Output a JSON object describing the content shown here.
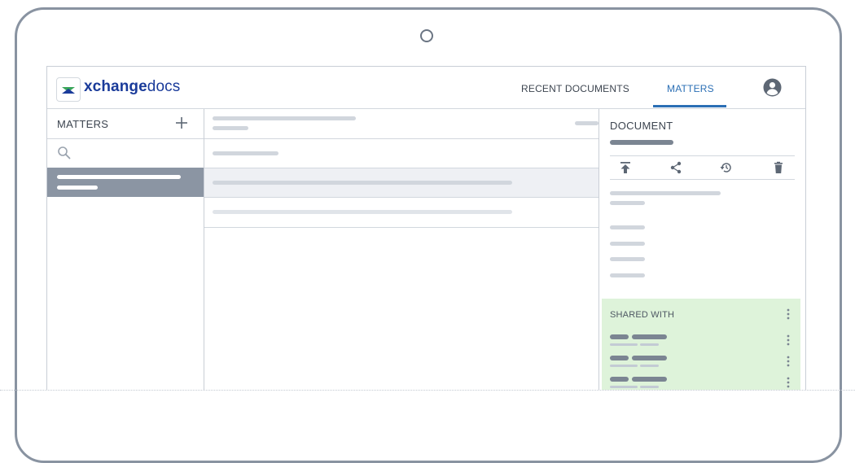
{
  "app": {
    "brand_bold": "xchange",
    "brand_light": "docs",
    "logo_colors": {
      "green": "#3aa55a",
      "navy": "#1a3b9a"
    }
  },
  "nav": {
    "recent_documents": "RECENT DOCUMENTS",
    "matters": "MATTERS",
    "active_tab": "MATTERS",
    "accent_color": "#2b6fb5"
  },
  "left_panel": {
    "title": "MATTERS",
    "add_icon": "plus-icon",
    "search_icon": "search-icon"
  },
  "document_panel": {
    "title": "DOCUMENT",
    "toolbar_icons": [
      "upload-icon",
      "share-icon",
      "history-icon",
      "trash-icon"
    ]
  },
  "shared_with": {
    "title": "SHARED WITH",
    "background": "#def3da",
    "entries_count": 3
  },
  "icons": {
    "profile": "user-avatar-icon",
    "more": "more-vertical-icon"
  }
}
